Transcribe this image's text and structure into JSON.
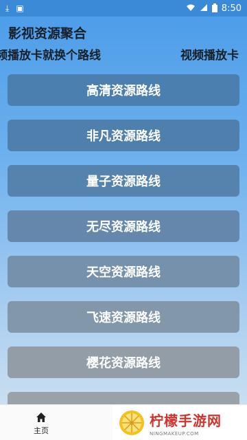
{
  "status_bar": {
    "time": "8:50",
    "left_icons": [
      "download-icon",
      "app-notification-icon"
    ],
    "right_icons": [
      "wifi-icon",
      "signal-icon",
      "battery-icon"
    ]
  },
  "app": {
    "title": "影视资源聚合",
    "marquee_left": "频播放卡就换个路线",
    "marquee_right": "视频播放卡"
  },
  "routes": [
    "高清资源路线",
    "非凡资源路线",
    "量子资源路线",
    "无尽资源路线",
    "天空资源路线",
    "飞速资源路线",
    "樱花资源路线",
    "..."
  ],
  "bottom_nav": {
    "home_label": "主页"
  },
  "watermark": {
    "title": "柠檬手游网",
    "subtitle": "NINGMAKEUP.COM"
  },
  "colors": {
    "status_bar": "#3a8ad8",
    "gradient_top": "#4a9be8",
    "gradient_bottom": "#d7e6f2",
    "button_top": "#4a7fb0",
    "button_bottom": "#9aa1a8",
    "watermark_red": "#d0342c"
  }
}
